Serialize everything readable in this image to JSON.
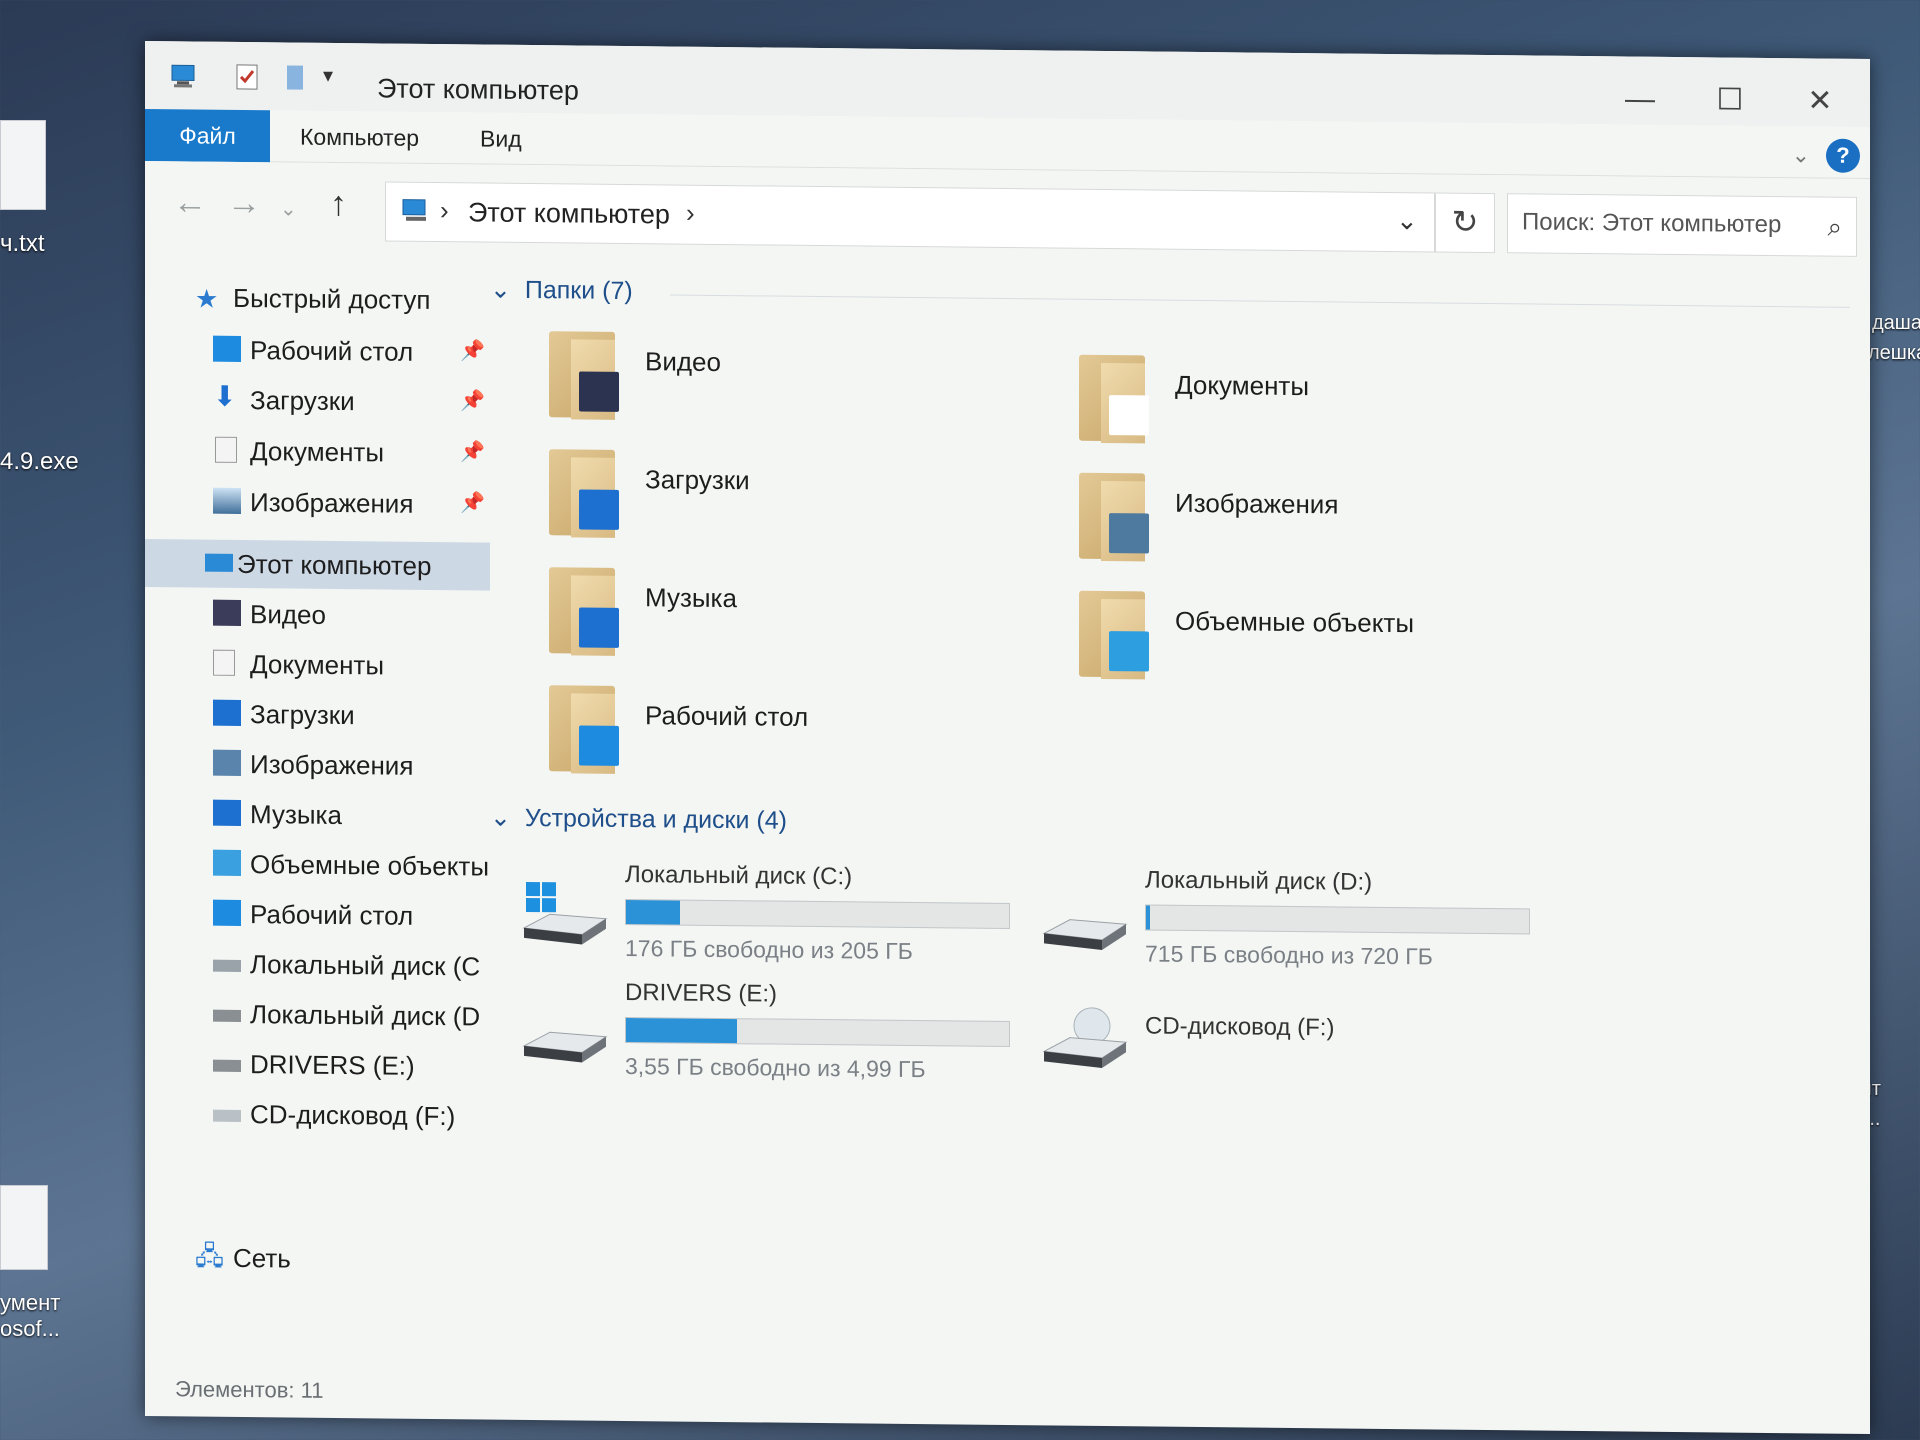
{
  "desktop": {
    "icons": [
      {
        "label": "ч.txt"
      },
      {
        "label": "4.9.exe"
      },
      {
        "label": "умент\nosof..."
      }
    ],
    "right_labels": [
      "даша",
      "лешка",
      "умент",
      "osof..."
    ]
  },
  "window": {
    "title": "Этот компьютер",
    "ribbon_tabs": [
      "Файл",
      "Компьютер",
      "Вид"
    ],
    "address": {
      "path": "Этот компьютер"
    },
    "search_placeholder": "Поиск: Этот компьютер",
    "help_label": "?"
  },
  "sidebar": {
    "quick_access": {
      "label": "Быстрый доступ"
    },
    "pinned": [
      {
        "label": "Рабочий стол",
        "icon": "desktop-icon"
      },
      {
        "label": "Загрузки",
        "icon": "downloads-icon"
      },
      {
        "label": "Документы",
        "icon": "documents-icon"
      },
      {
        "label": "Изображения",
        "icon": "pictures-icon"
      }
    ],
    "this_pc": {
      "label": "Этот компьютер"
    },
    "pc_items": [
      {
        "label": "Видео",
        "icon": "video-icon"
      },
      {
        "label": "Документы",
        "icon": "documents-icon"
      },
      {
        "label": "Загрузки",
        "icon": "downloads-icon"
      },
      {
        "label": "Изображения",
        "icon": "pictures-icon"
      },
      {
        "label": "Музыка",
        "icon": "music-icon"
      },
      {
        "label": "Объемные объекты",
        "icon": "3d-objects-icon"
      },
      {
        "label": "Рабочий стол",
        "icon": "desktop-icon"
      },
      {
        "label": "Локальный диск (C",
        "icon": "drive-c-icon"
      },
      {
        "label": "Локальный диск (D",
        "icon": "drive-icon"
      },
      {
        "label": "DRIVERS (E:)",
        "icon": "drive-icon"
      },
      {
        "label": "CD-дисковод (F:)",
        "icon": "cd-drive-icon"
      }
    ],
    "network": {
      "label": "Сеть"
    }
  },
  "content": {
    "folders_header": "Папки (7)",
    "folders": [
      {
        "label": "Видео",
        "icon": "video-folder-icon"
      },
      {
        "label": "Документы",
        "icon": "documents-folder-icon"
      },
      {
        "label": "Загрузки",
        "icon": "downloads-folder-icon"
      },
      {
        "label": "Изображения",
        "icon": "pictures-folder-icon"
      },
      {
        "label": "Музыка",
        "icon": "music-folder-icon"
      },
      {
        "label": "Объемные объекты",
        "icon": "3d-objects-folder-icon"
      },
      {
        "label": "Рабочий стол",
        "icon": "desktop-folder-icon"
      }
    ],
    "devices_header": "Устройства и диски (4)",
    "drives": [
      {
        "name": "Локальный диск (C:)",
        "free": "176 ГБ свободно из 205 ГБ",
        "used_fraction": 0.14,
        "icon": "windows-drive-icon"
      },
      {
        "name": "Локальный диск (D:)",
        "free": "715 ГБ свободно из 720 ГБ",
        "used_fraction": 0.01,
        "icon": "drive-icon"
      },
      {
        "name": "DRIVERS (E:)",
        "free": "3,55 ГБ свободно из 4,99 ГБ",
        "used_fraction": 0.29,
        "icon": "drive-icon"
      },
      {
        "name": "CD-дисковод (F:)",
        "free": "",
        "used_fraction": null,
        "icon": "cd-drive-icon"
      }
    ]
  },
  "status": {
    "items": "Элементов: 11"
  },
  "colors": {
    "accent": "#1979ca",
    "bar_fill": "#2b92d8",
    "group_header": "#1f4f8a",
    "selected": "#cdd8e5"
  }
}
